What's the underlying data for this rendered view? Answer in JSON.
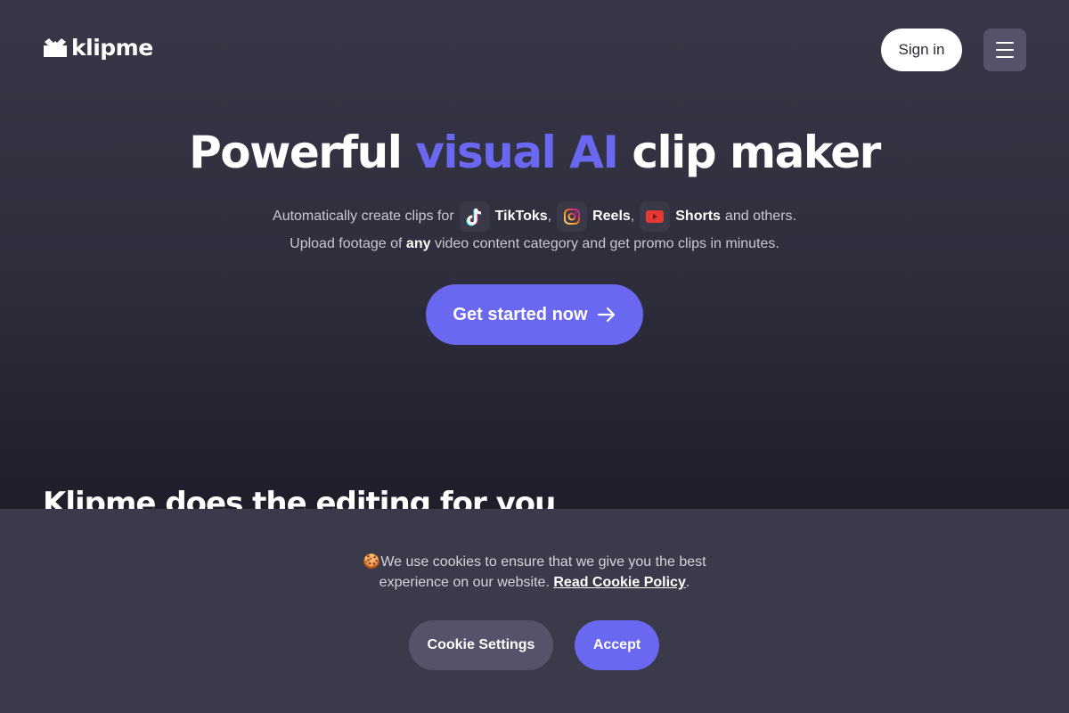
{
  "header": {
    "logo_text": "klipme",
    "signin_label": "Sign in",
    "menu_icon": "hamburger-menu-icon"
  },
  "hero": {
    "title_part1": "Powerful ",
    "title_accent": "visual AI",
    "title_part2": " clip maker",
    "accent_color": "#6a67f0",
    "subline1_prefix": "Automatically create clips for",
    "platforms": [
      {
        "name": "TikToks",
        "icon": "tiktok-icon",
        "suffix": ","
      },
      {
        "name": "Reels",
        "icon": "instagram-icon",
        "suffix": ","
      },
      {
        "name": "Shorts",
        "icon": "youtube-icon",
        "suffix": ""
      }
    ],
    "subline1_suffix": "and others.",
    "subline2_prefix": "Upload footage of",
    "subline2_bold": "any",
    "subline2_suffix": "video content category and get promo clips in minutes.",
    "cta_label": "Get started now",
    "cta_icon": "arrow-right-icon"
  },
  "section": {
    "title": "Klipme does the editing for you"
  },
  "cookie_banner": {
    "emoji": "🍪",
    "text_line1": "We use cookies to ensure that we give you the best",
    "text_line2": "experience on our website.",
    "policy_link": "Read Cookie Policy",
    "trailing": ".",
    "settings_label": "Cookie Settings",
    "accept_label": "Accept"
  }
}
